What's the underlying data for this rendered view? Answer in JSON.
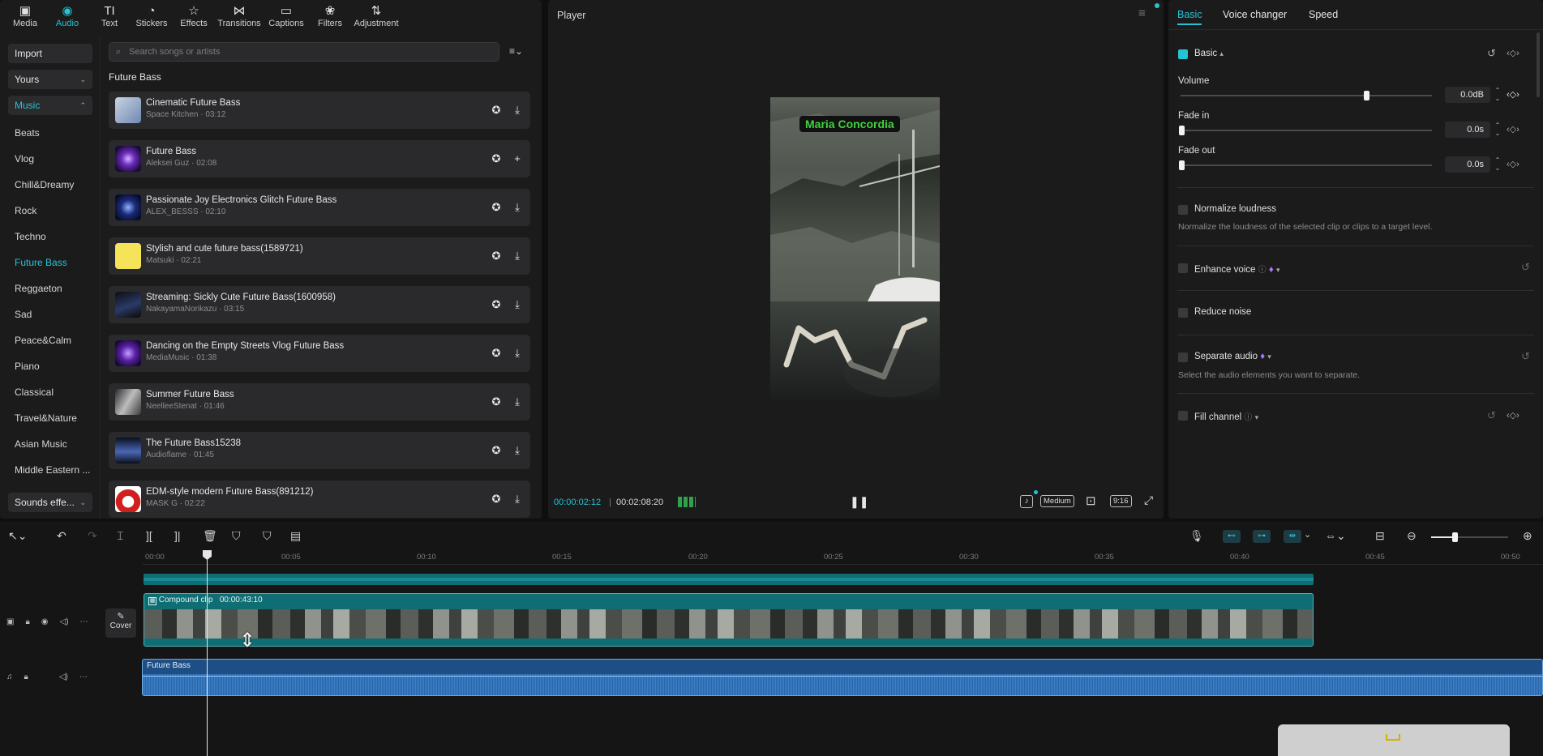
{
  "toolbar": {
    "tabs": [
      {
        "label": "Media",
        "icon": "media-icon"
      },
      {
        "label": "Audio",
        "icon": "audio-icon"
      },
      {
        "label": "Text",
        "icon": "text-icon"
      },
      {
        "label": "Stickers",
        "icon": "stickers-icon"
      },
      {
        "label": "Effects",
        "icon": "effects-icon"
      },
      {
        "label": "Transitions",
        "icon": "transitions-icon"
      },
      {
        "label": "Captions",
        "icon": "captions-icon"
      },
      {
        "label": "Filters",
        "icon": "filters-icon"
      },
      {
        "label": "Adjustment",
        "icon": "adjustment-icon"
      }
    ],
    "active": "Audio"
  },
  "sidebar": {
    "import": "Import",
    "yours": "Yours",
    "music": "Music",
    "categories": [
      "Beats",
      "Vlog",
      "Chill&Dreamy",
      "Rock",
      "Techno",
      "Future Bass",
      "Reggaeton",
      "Sad",
      "Peace&Calm",
      "Piano",
      "Classical",
      "Travel&Nature",
      "Asian Music",
      "Middle Eastern ..."
    ],
    "active_category": "Future Bass",
    "sound_effects": "Sounds effe..."
  },
  "library": {
    "search_placeholder": "Search songs or artists",
    "section_title": "Future Bass",
    "songs": [
      {
        "title": "Cinematic Future Bass",
        "meta": "Space Kitchen · 03:12"
      },
      {
        "title": "Future Bass",
        "meta": "Aleksei Guz · 02:08"
      },
      {
        "title": "Passionate Joy Electronics Glitch Future Bass",
        "meta": "ALEX_BESSS · 02:10"
      },
      {
        "title": "Stylish and cute future bass(1589721)",
        "meta": "Matsuki · 02:21"
      },
      {
        "title": "Streaming: Sickly Cute Future Bass(1600958)",
        "meta": "NakayamaNorikazu · 03:15"
      },
      {
        "title": "Dancing on the Empty Streets Vlog Future Bass",
        "meta": "MediaMusic · 01:38"
      },
      {
        "title": "Summer Future Bass",
        "meta": "NeelleeStenat · 01:46"
      },
      {
        "title": "The Future Bass15238",
        "meta": "Audioflame · 01:45"
      },
      {
        "title": "EDM-style modern Future Bass(891212)",
        "meta": "MASK G · 02:22"
      }
    ]
  },
  "player": {
    "title": "Player",
    "overlay_text": "Maria Concordia",
    "current_time": "00:00:02:12",
    "total_time": "00:02:08:20",
    "quality": "Medium",
    "ratio": "9:16"
  },
  "inspector": {
    "tabs": [
      "Basic",
      "Voice changer",
      "Speed"
    ],
    "active_tab": "Basic",
    "section": "Basic",
    "volume_label": "Volume",
    "volume_value": "0.0dB",
    "volume_level": 0.75,
    "fade_in_label": "Fade in",
    "fade_in_value": "0.0s",
    "fade_out_label": "Fade out",
    "fade_out_value": "0.0s",
    "normalize_label": "Normalize loudness",
    "normalize_desc": "Normalize the loudness of the selected clip or clips to a target level.",
    "enhance_label": "Enhance voice",
    "reduce_label": "Reduce noise",
    "separate_label": "Separate audio",
    "separate_desc": "Select the audio elements you want to separate.",
    "fill_label": "Fill channel"
  },
  "timeline": {
    "ruler": [
      "00:00",
      "00:05",
      "00:10",
      "00:15",
      "00:20",
      "00:25",
      "00:30",
      "00:35",
      "00:40",
      "00:45",
      "00:50"
    ],
    "compound_label": "Compound clip",
    "compound_duration": "00:00:43:10",
    "cover_label": "Cover",
    "audio_clip_label": "Future Bass"
  },
  "colors": {
    "accent": "#25c4d4",
    "audio_clip": "#1d4f86",
    "video_clip": "#0f6e73"
  }
}
